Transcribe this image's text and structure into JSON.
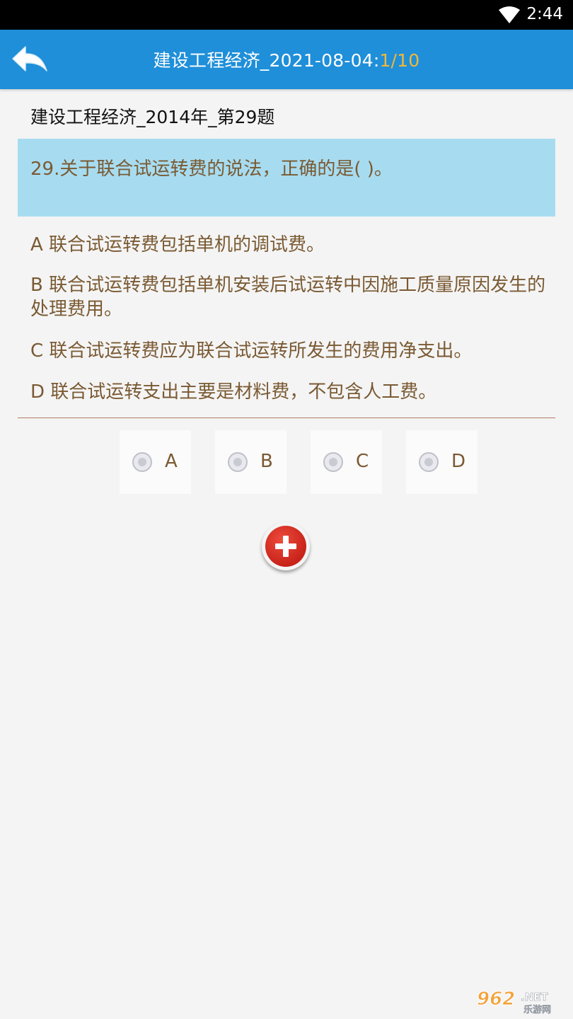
{
  "status_bar": {
    "time": "2:44",
    "wifi_icon": "wifi-icon"
  },
  "app_bar": {
    "back_icon": "back-arrow-icon",
    "title": "建设工程经济_2021-08-04",
    "separator": ":",
    "counter": "1/10",
    "colors": {
      "background": "#1f8fd9",
      "counter": "#f2b838"
    }
  },
  "subtitle": "建设工程经济_2014年_第29题",
  "question": {
    "text": "29.关于联合试运转费的说法，正确的是(    )。",
    "background": "#a7dcf0"
  },
  "options": [
    {
      "text": "A 联合试运转费包括单机的调试费。"
    },
    {
      "text": "B 联合试运转费包括单机安装后试运转中因施工质量原因发生的处理费用。"
    },
    {
      "text": "C 联合试运转费应为联合试运转所发生的费用净支出。"
    },
    {
      "text": "D 联合试运转支出主要是材料费，不包含人工费。"
    }
  ],
  "choices": [
    {
      "label": "A",
      "selected": false
    },
    {
      "label": "B",
      "selected": false
    },
    {
      "label": "C",
      "selected": false
    },
    {
      "label": "D",
      "selected": false
    }
  ],
  "add_button": {
    "icon": "plus-icon",
    "color": "#d6281e"
  },
  "watermark": {
    "text": "962.NET",
    "subtext": "乐游网"
  }
}
